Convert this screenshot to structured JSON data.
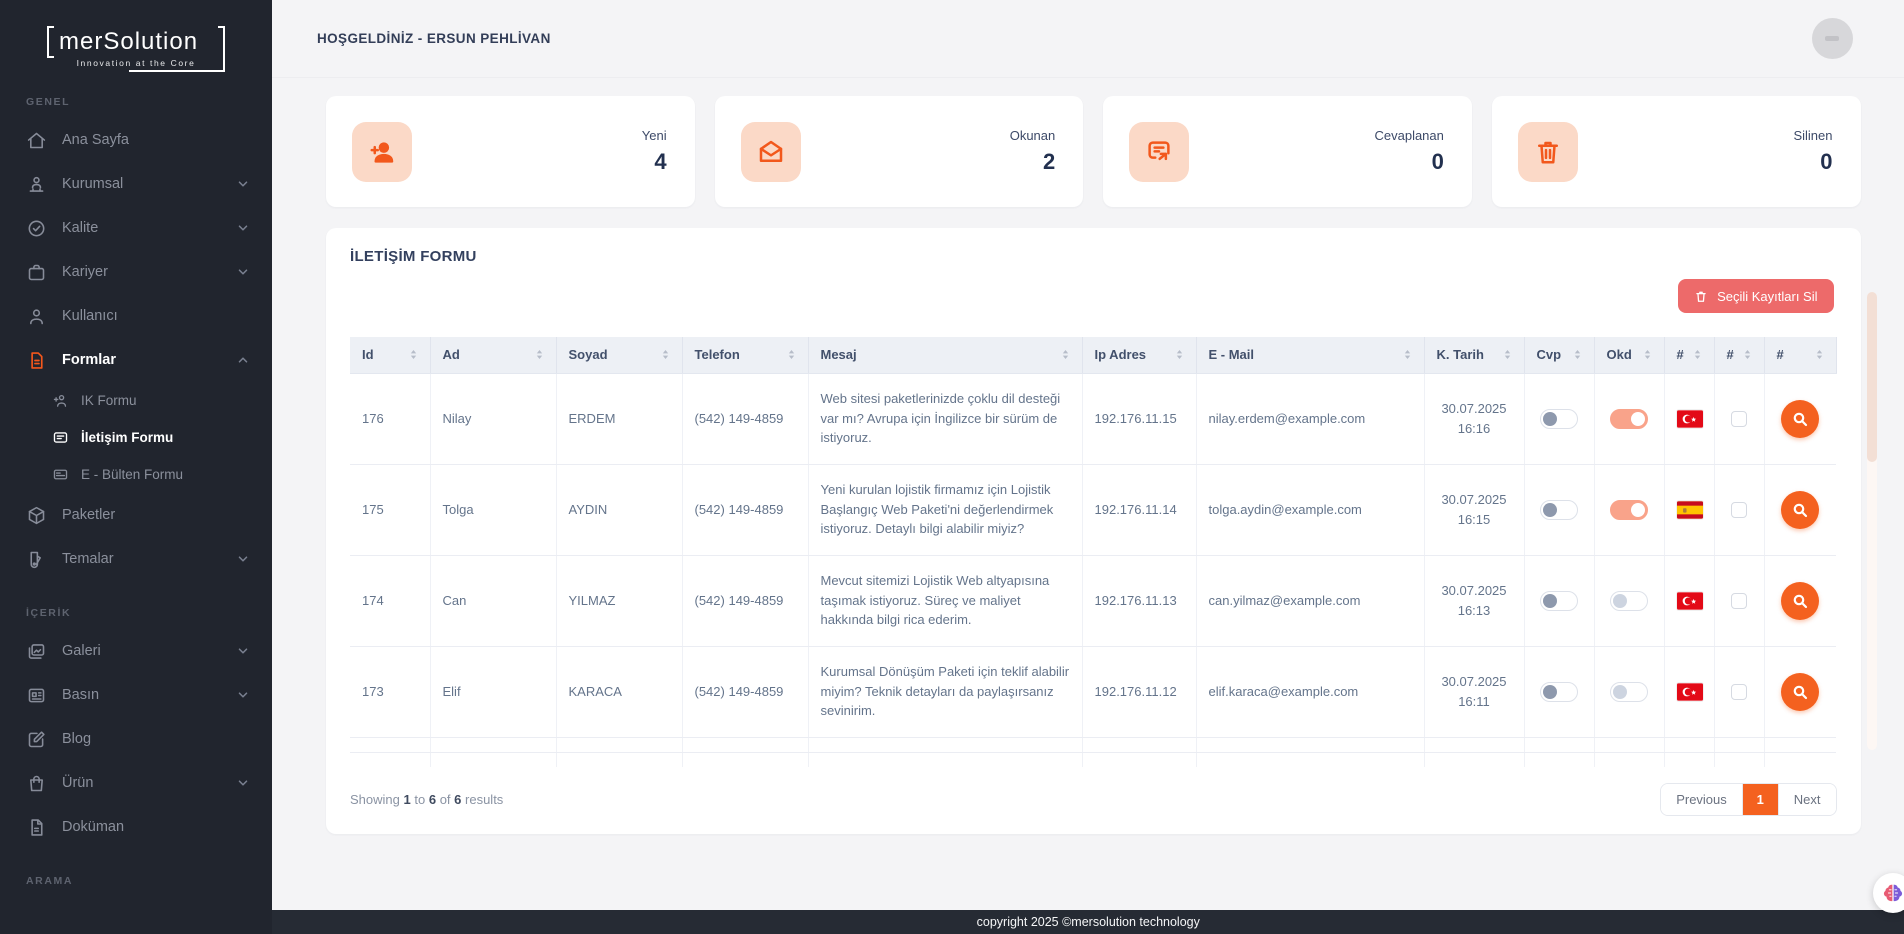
{
  "brand": {
    "name": "merSolution",
    "tagline": "Innovation at the Core"
  },
  "topbar": {
    "welcome": "HOŞGELDİNİZ - ERSUN PEHLİVAN"
  },
  "colors": {
    "accent": "#F4611F",
    "accent_soft": "#FBD9C7",
    "danger": "#ED6A6A",
    "toggle_on": "#F9A38A",
    "flag_red": "#E30A17",
    "sidebar_bg": "#21252E",
    "footer_bg": "#262B34",
    "title_navy": "#33405E"
  },
  "sidebar": {
    "entries": [
      {
        "type": "section",
        "label": "GENEL",
        "name": "sidebar-section-genel"
      },
      {
        "type": "item",
        "label": "Ana Sayfa",
        "icon": "home-icon",
        "icon_ref": "#i-home",
        "chev": "none",
        "state": "normal",
        "name": "sidebar-item-ana-sayfa"
      },
      {
        "type": "item",
        "label": "Kurumsal",
        "icon": "org-person-icon",
        "icon_ref": "#i-org",
        "chev": "down",
        "state": "normal",
        "name": "sidebar-item-kurumsal"
      },
      {
        "type": "item",
        "label": "Kalite",
        "icon": "quality-badge-icon",
        "icon_ref": "#i-badge",
        "chev": "down",
        "state": "normal",
        "name": "sidebar-item-kalite"
      },
      {
        "type": "item",
        "label": "Kariyer",
        "icon": "briefcase-icon",
        "icon_ref": "#i-case",
        "chev": "down",
        "state": "normal",
        "name": "sidebar-item-kariyer"
      },
      {
        "type": "item",
        "label": "Kullanıcı",
        "icon": "user-icon",
        "icon_ref": "#i-user",
        "chev": "none",
        "state": "normal",
        "name": "sidebar-item-kullanici"
      },
      {
        "type": "item",
        "label": "Formlar",
        "icon": "form-file-icon",
        "icon_ref": "#i-file",
        "chev": "up",
        "state": "open",
        "accent": "true",
        "name": "sidebar-item-formlar"
      },
      {
        "type": "subitem",
        "label": "IK Formu",
        "icon": "user-plus-icon",
        "icon_ref": "#i-user-plus",
        "chev": "none",
        "state": "normal",
        "name": "sidebar-item-ik-formu"
      },
      {
        "type": "subitem",
        "label": "İletişim Formu",
        "icon": "mail-message-icon",
        "icon_ref": "#i-mail",
        "chev": "none",
        "state": "active",
        "name": "sidebar-item-iletisim-formu"
      },
      {
        "type": "subitem",
        "label": "E - Bülten Formu",
        "icon": "newsletter-card-icon",
        "icon_ref": "#i-card",
        "chev": "none",
        "state": "normal",
        "name": "sidebar-item-e-bulten-formu"
      },
      {
        "type": "item",
        "label": "Paketler",
        "icon": "package-box-icon",
        "icon_ref": "#i-box",
        "chev": "none",
        "state": "normal",
        "name": "sidebar-item-paketler"
      },
      {
        "type": "item",
        "label": "Temalar",
        "icon": "themes-swatch-icon",
        "icon_ref": "#i-theme",
        "chev": "down",
        "state": "normal",
        "name": "sidebar-item-temalar"
      },
      {
        "type": "section",
        "label": "İÇERİK",
        "name": "sidebar-section-icerik"
      },
      {
        "type": "item",
        "label": "Galeri",
        "icon": "gallery-image-icon",
        "icon_ref": "#i-gallery",
        "chev": "down",
        "state": "normal",
        "name": "sidebar-item-galeri"
      },
      {
        "type": "item",
        "label": "Basın",
        "icon": "newspaper-icon",
        "icon_ref": "#i-news",
        "chev": "down",
        "state": "normal",
        "name": "sidebar-item-basin"
      },
      {
        "type": "item",
        "label": "Blog",
        "icon": "edit-pencil-icon",
        "icon_ref": "#i-edit",
        "chev": "none",
        "state": "normal",
        "name": "sidebar-item-blog"
      },
      {
        "type": "item",
        "label": "Ürün",
        "icon": "shopping-bag-icon",
        "icon_ref": "#i-bag",
        "chev": "down",
        "state": "normal",
        "name": "sidebar-item-urun"
      },
      {
        "type": "item",
        "label": "Doküman",
        "icon": "document-icon",
        "icon_ref": "#i-doc",
        "chev": "none",
        "state": "normal",
        "name": "sidebar-item-dokuman"
      },
      {
        "type": "section",
        "label": "ARAMA",
        "name": "sidebar-section-arama"
      }
    ]
  },
  "stats": {
    "cards": [
      {
        "label": "Yeni",
        "value": "4",
        "icon": "user-add-icon",
        "icon_ref": "#i-stat-user"
      },
      {
        "label": "Okunan",
        "value": "2",
        "icon": "open-mail-icon",
        "icon_ref": "#i-stat-mail"
      },
      {
        "label": "Cevaplanan",
        "value": "0",
        "icon": "reply-message-icon",
        "icon_ref": "#i-stat-reply"
      },
      {
        "label": "Silinen",
        "value": "0",
        "icon": "trash-icon",
        "icon_ref": "#i-stat-trash"
      }
    ]
  },
  "panel": {
    "title": "İLETİŞİM FORMU",
    "delete_button": "Seçili Kayıtları Sil",
    "table": {
      "columns": [
        "Id",
        "Ad",
        "Soyad",
        "Telefon",
        "Mesaj",
        "Ip Adres",
        "E - Mail",
        "K. Tarih",
        "Cvp",
        "Okd",
        "#",
        "#",
        "#"
      ],
      "rows": [
        {
          "id": "176",
          "ad": "Nilay",
          "soyad": "ERDEM",
          "telefon": "(542) 149-4859",
          "mesaj": "Web sitesi paketlerinizde çoklu dil desteği var mı? Avrupa için İngilizce bir sürüm de istiyoruz.",
          "ip": "192.176.11.15",
          "email": "nilay.erdem@example.com",
          "tarih_date": "30.07.2025",
          "tarih_time": "16:16",
          "cvp": "off-dark",
          "okd": "on",
          "flag": "tr"
        },
        {
          "id": "175",
          "ad": "Tolga",
          "soyad": "AYDIN",
          "telefon": "(542) 149-4859",
          "mesaj": "Yeni kurulan lojistik firmamız için Lojistik Başlangıç Web Paketi'ni değerlendirmek istiyoruz. Detaylı bilgi alabilir miyiz?",
          "ip": "192.176.11.14",
          "email": "tolga.aydin@example.com",
          "tarih_date": "30.07.2025",
          "tarih_time": "16:15",
          "cvp": "off-dark",
          "okd": "on",
          "flag": "es"
        },
        {
          "id": "174",
          "ad": "Can",
          "soyad": "YILMAZ",
          "telefon": "(542) 149-4859",
          "mesaj": "Mevcut sitemizi Lojistik Web altyapısına taşımak istiyoruz. Süreç ve maliyet hakkında bilgi rica ederim.",
          "ip": "192.176.11.13",
          "email": "can.yilmaz@example.com",
          "tarih_date": "30.07.2025",
          "tarih_time": "16:13",
          "cvp": "off-dark",
          "okd": "off-light",
          "flag": "tr"
        },
        {
          "id": "173",
          "ad": "Elif",
          "soyad": "KARACA",
          "telefon": "(542) 149-4859",
          "mesaj": "Kurumsal Dönüşüm Paketi için teklif alabilir miyim? Teknik detayları da paylaşırsanız sevinirim.",
          "ip": "192.176.11.12",
          "email": "elif.karaca@example.com",
          "tarih_date": "30.07.2025",
          "tarih_time": "16:11",
          "cvp": "off-dark",
          "okd": "off-light",
          "flag": "tr"
        }
      ]
    },
    "summary": {
      "showing": "Showing",
      "from": "1",
      "to_word": "to",
      "to": "6",
      "of_word": "of",
      "total": "6",
      "results_word": "results"
    },
    "pagination": {
      "previous": "Previous",
      "current": "1",
      "next": "Next"
    }
  },
  "footer": {
    "copyright": "copyright 2025 ©mersolution technology"
  }
}
